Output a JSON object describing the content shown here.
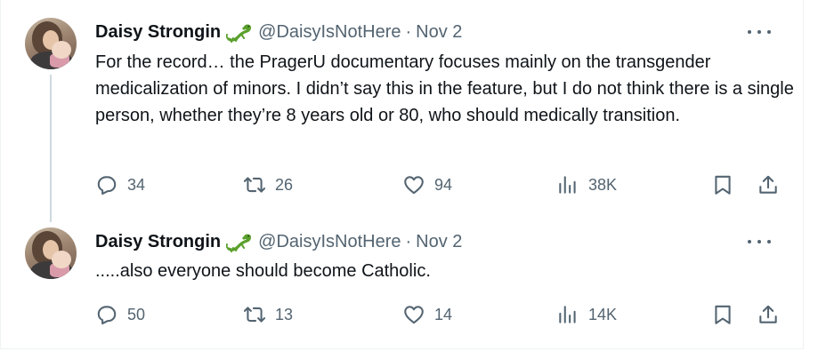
{
  "tweets": [
    {
      "author": "Daisy Strongin",
      "handle": "@DaisyIsNotHere",
      "separator": "·",
      "date": "Nov 2",
      "text": "For the record… the PragerU documentary focuses mainly on the transgender medicalization of minors. I didn’t say this in the feature, but I do not think there is a single person, whether they’re 8 years old or 80, who should medically transition.",
      "replies": "34",
      "reposts": "26",
      "likes": "94",
      "views": "38K"
    },
    {
      "author": "Daisy Strongin",
      "handle": "@DaisyIsNotHere",
      "separator": "·",
      "date": "Nov 2",
      "text": ".....also everyone should become Catholic.",
      "replies": "50",
      "reposts": "13",
      "likes": "14",
      "views": "14K"
    }
  ],
  "icons": {
    "name_badge": "lizard-emoji-icon",
    "more": "more-options-icon",
    "reply": "reply-icon",
    "repost": "repost-icon",
    "like": "heart-icon",
    "views": "views-chart-icon",
    "bookmark": "bookmark-icon",
    "share": "share-icon"
  },
  "colors": {
    "text": "#0f1419",
    "secondary": "#536471",
    "thread_line": "#cfd9de",
    "border": "#eff3f4",
    "lizard": "#5aa02c"
  }
}
